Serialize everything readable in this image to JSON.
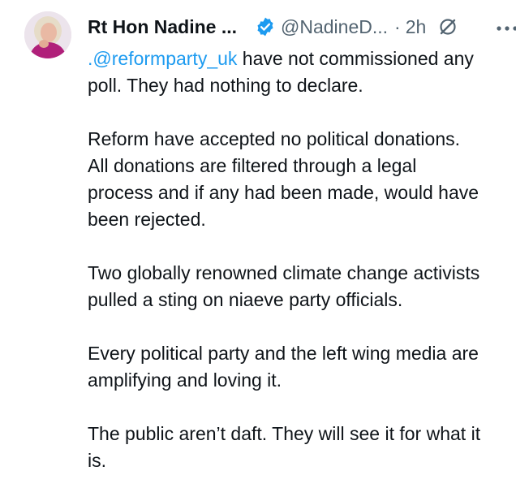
{
  "author": {
    "display_name": "Rt Hon Nadine ...",
    "handle": "@NadineD...",
    "separator": "·",
    "time": "2h"
  },
  "colors": {
    "text": "#0f1419",
    "secondary": "#536471",
    "link": "#1d9bf0",
    "verified": "#1d9bf0"
  },
  "icons": {
    "verified": "verified-badge-icon",
    "grok": "grok-icon",
    "more": "more-options-icon"
  },
  "tweet": {
    "mention": ".@reformparty_uk",
    "p1_l1_rest": " have not commissioned any",
    "p1_l2": "poll. They had nothing to declare.",
    "p2_l1": "Reform have accepted no political donations.",
    "p2_l2": "All donations are filtered through a legal",
    "p2_l3": "process and if any had been made, would have",
    "p2_l4": "been rejected.",
    "p3_l1": "Two globally renowned climate change activists",
    "p3_l2": "pulled a sting on niaeve party officials.",
    "p4_l1": "Every political party and the left wing media are",
    "p4_l2": "amplifying and loving it.",
    "p5_l1": "The public aren’t daft. They will see it for what it",
    "p5_l2": "is."
  }
}
